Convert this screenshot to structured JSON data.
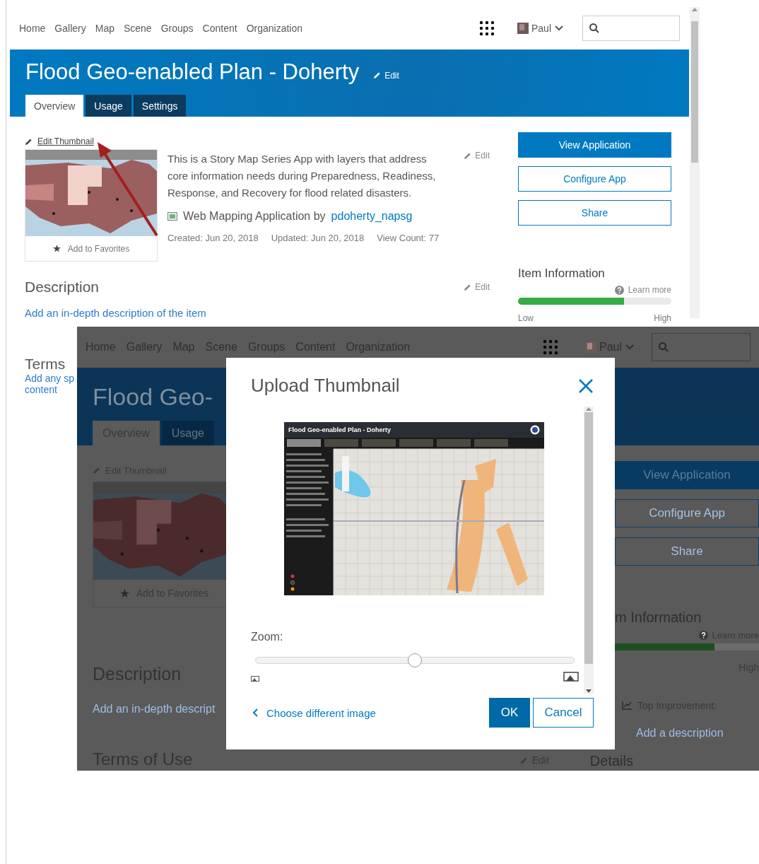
{
  "background_page": {
    "nav": {
      "links": [
        "Home",
        "Gallery",
        "Map",
        "Scene",
        "Groups",
        "Content",
        "Organization"
      ],
      "user": "Paul"
    },
    "title": "Flood Geo-enabled Plan - Doherty",
    "title_edit": "Edit",
    "tabs": [
      {
        "label": "Overview",
        "selected": true
      },
      {
        "label": "Usage",
        "selected": false
      },
      {
        "label": "Settings",
        "selected": false
      }
    ],
    "thumbnail": {
      "edit_label": "Edit Thumbnail",
      "favorites": "Add to Favorites"
    },
    "summary": {
      "text": "This is a Story Map Series App with layers that address core information needs during Preparedness, Readiness, Response, and Recovery for flood related disasters.",
      "edit": "Edit",
      "type_label": "Web Mapping Application by",
      "owner": "pdoherty_napsg",
      "created": "Created: Jun 20, 2018",
      "updated": "Updated: Jun 20, 2018",
      "views": "View Count: 77"
    },
    "actions": [
      {
        "label": "View Application",
        "kind": "primary"
      },
      {
        "label": "Configure App",
        "kind": "outline"
      },
      {
        "label": "Share",
        "kind": "outline"
      }
    ],
    "item_information": {
      "title": "Item Information",
      "learn_more": "Learn more",
      "level": 0.69,
      "low": "Low",
      "high": "High"
    },
    "description": {
      "title": "Description",
      "edit": "Edit",
      "link": "Add an in-depth description of the item"
    },
    "terms": {
      "title": "Terms",
      "link_lines": [
        "Add any sp",
        "content"
      ]
    }
  },
  "overlay_page": {
    "nav": {
      "links": [
        "Home",
        "Gallery",
        "Map",
        "Scene",
        "Groups",
        "Content",
        "Organization"
      ],
      "user": "Paul"
    },
    "title": "Flood Geo-",
    "tabs": [
      {
        "label": "Overview",
        "selected": true
      },
      {
        "label": "Usage",
        "selected": false
      }
    ],
    "edit_thumbnail": "Edit Thumbnail",
    "favorites": "Add to Favorites",
    "description_title": "Description",
    "description_link": "Add an in-depth descript",
    "actions": [
      {
        "label": "View Application",
        "kind": "primary"
      },
      {
        "label": "Configure App",
        "kind": "outline"
      },
      {
        "label": "Share",
        "kind": "outline"
      }
    ],
    "item_information": {
      "title": "m Information",
      "learn_more": "Learn more",
      "level": 0.69,
      "high": "High"
    },
    "top_improvement": {
      "label": "Top Improvement:",
      "link": "Add a description"
    },
    "terms_title": "Terms of Use",
    "terms_edit": "Edit",
    "details_title": "Details"
  },
  "dialog": {
    "title": "Upload Thumbnail",
    "preview": {
      "title": "Flood Geo-enabled Plan - Doherty"
    },
    "zoom_label": "Zoom:",
    "zoom": {
      "level": 0.5
    },
    "back_link": "Choose different image",
    "buttons": [
      {
        "label": "OK",
        "kind": "primary"
      },
      {
        "label": "Cancel",
        "kind": "secondary"
      }
    ]
  }
}
